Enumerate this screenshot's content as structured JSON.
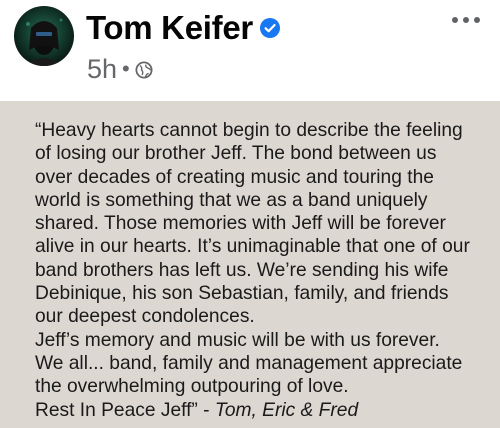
{
  "post": {
    "author": "Tom Keifer",
    "timestamp": "5h",
    "separator": "•",
    "audience_icon": "globe-icon",
    "verified_icon": "verified-badge-icon",
    "more_icon": "more-options-icon",
    "quote_body": "“Heavy hearts cannot begin to describe the feeling\nof losing our brother Jeff. The bond between us\nover decades of creating music and touring the\nworld is something that we as a band uniquely\nshared. Those memories with Jeff will be forever\nalive in our hearts. It’s unimaginable that one of our\nband brothers has left us. We’re sending his wife\nDebinique, his son Sebastian, family, and friends\nour deepest condolences.\nJeff’s memory and music will be with us forever.\nWe all... band, family and management appreciate\nthe overwhelming outpouring of love.\nRest In Peace Jeff”",
    "attribution_sep": " - ",
    "attribution": "Tom, Eric & Fred"
  },
  "colors": {
    "verified_blue": "#1877f2",
    "secondary_text": "#65676b",
    "post_background": "#ddd7d2"
  }
}
